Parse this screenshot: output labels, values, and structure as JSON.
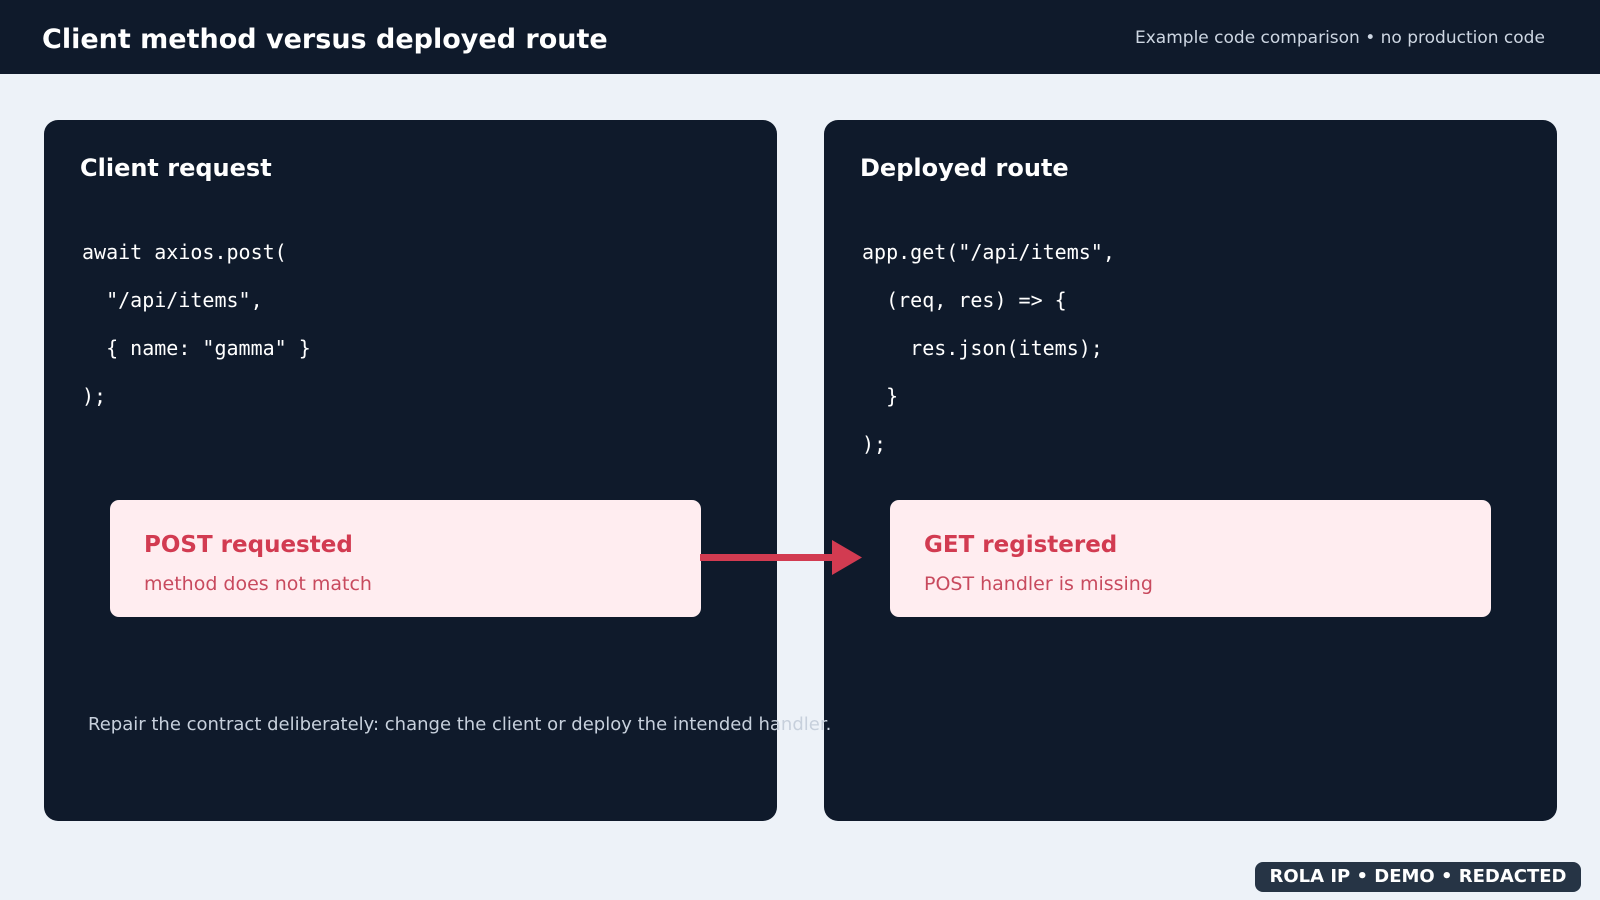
{
  "header": {
    "title": "Client method versus deployed route",
    "subtitle": "Example code comparison • no production code"
  },
  "left_panel": {
    "title": "Client request",
    "code_lines": [
      "await axios.post(",
      "  \"/api/items\",",
      "  { name: \"gamma\" }",
      ");"
    ],
    "note": {
      "title": "POST requested",
      "subtitle": "method does not match"
    }
  },
  "right_panel": {
    "title": "Deployed route",
    "code_lines": [
      "app.get(\"/api/items\",",
      "  (req, res) => {",
      "    res.json(items);",
      "  }",
      ");"
    ],
    "note": {
      "title": "GET registered",
      "subtitle": "POST handler is missing"
    }
  },
  "footnote": "Repair the contract deliberately: change the client or deploy the intended handler.",
  "watermark": "ROLA IP  •  DEMO  •  REDACTED",
  "colors": {
    "header_bg": "#0f1a2b",
    "panel_bg": "#0f1a2b",
    "page_bg": "#edf2f8",
    "note_bg": "#ffedf0",
    "accent_red": "#d23b51"
  },
  "icons": {
    "connector": "arrow-right-icon"
  }
}
